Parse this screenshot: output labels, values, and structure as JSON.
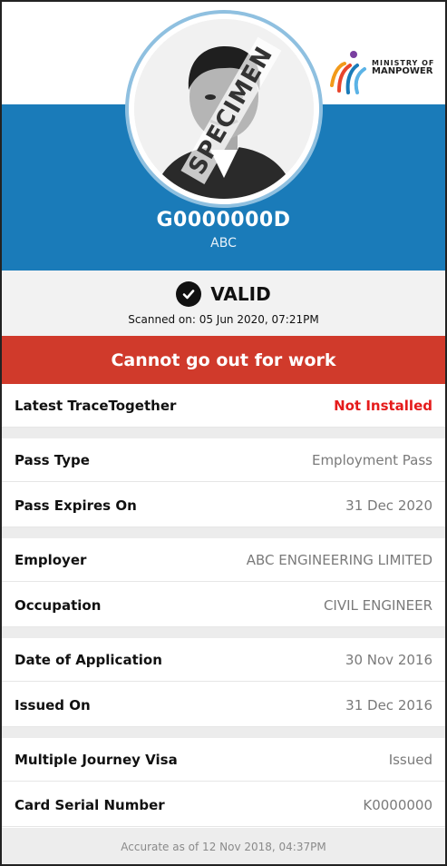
{
  "header": {
    "id_number": "G0000000D",
    "name": "ABC",
    "photo_watermark": "SPECIMEN",
    "logo": {
      "icon": "mom-logo-icon",
      "line1": "MINISTRY OF",
      "line2": "MANPOWER"
    }
  },
  "status": {
    "icon": "check-circle-icon",
    "text": "VALID",
    "scanned": "Scanned on: 05 Jun 2020, 07:21PM"
  },
  "alert": {
    "text": "Cannot go out for work",
    "color": "#d03a2b"
  },
  "details": [
    {
      "label": "Latest TraceTogether",
      "value": "Not Installed",
      "highlight": true
    },
    {
      "label": "Pass Type",
      "value": "Employment Pass"
    },
    {
      "label": "Pass Expires On",
      "value": "31 Dec 2020"
    },
    {
      "label": "Employer",
      "value": "ABC ENGINEERING LIMITED"
    },
    {
      "label": "Occupation",
      "value": "CIVIL ENGINEER"
    },
    {
      "label": "Date of Application",
      "value": "30 Nov 2016"
    },
    {
      "label": "Issued On",
      "value": "31 Dec 2016"
    },
    {
      "label": "Multiple Journey Visa",
      "value": "Issued"
    },
    {
      "label": "Card Serial Number",
      "value": "K0000000"
    }
  ],
  "footer": {
    "text": "Accurate as of 12 Nov 2018, 04:37PM"
  },
  "colors": {
    "header_blue": "#1a7bb9",
    "alert_red": "#d03a2b",
    "highlight_red": "#e51b1b"
  }
}
